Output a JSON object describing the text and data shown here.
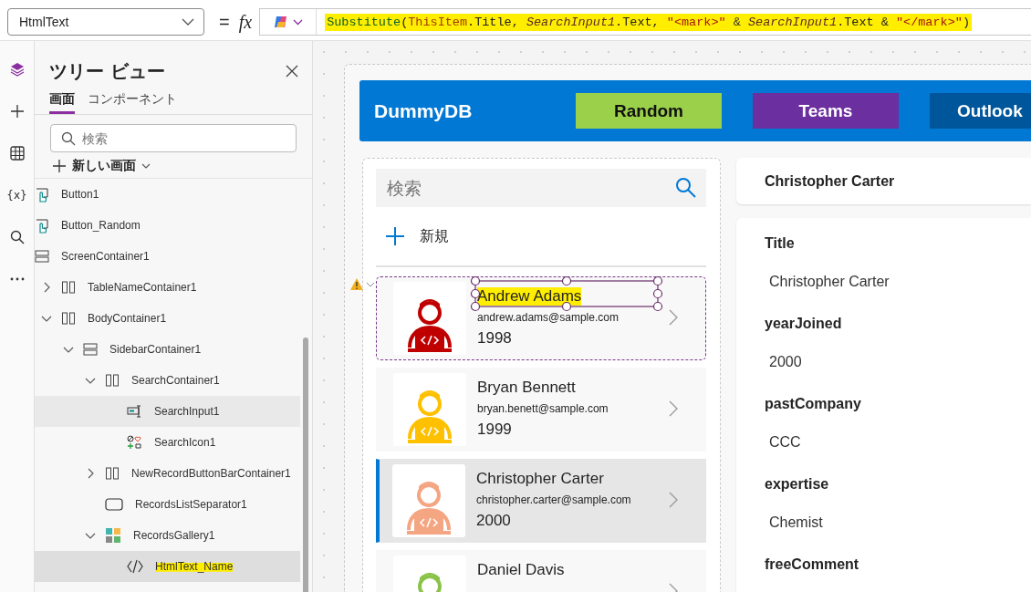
{
  "formula_bar": {
    "property": "HtmlText",
    "equals": "=",
    "fx": "fx",
    "tokens": [
      {
        "text": "Substitute",
        "kind": "function"
      },
      {
        "text": "(",
        "kind": "punct"
      },
      {
        "text": "ThisItem",
        "kind": "keyword"
      },
      {
        "text": ".Title, ",
        "kind": "punct"
      },
      {
        "text": "SearchInput1",
        "kind": "control"
      },
      {
        "text": ".Text, ",
        "kind": "punct"
      },
      {
        "text": "\"<mark>\"",
        "kind": "string"
      },
      {
        "text": " & ",
        "kind": "operator"
      },
      {
        "text": "SearchInput1",
        "kind": "control"
      },
      {
        "text": ".Text & ",
        "kind": "punct"
      },
      {
        "text": "\"</mark>\"",
        "kind": "string"
      },
      {
        "text": ")",
        "kind": "punct"
      }
    ],
    "highlighted": true
  },
  "rail": [
    {
      "kind": "layers",
      "selected": true
    },
    {
      "kind": "plus",
      "selected": false
    },
    {
      "kind": "table",
      "selected": false
    },
    {
      "kind": "variables",
      "glyph": "{x}",
      "selected": false
    },
    {
      "kind": "search",
      "selected": false
    },
    {
      "kind": "more",
      "selected": false
    }
  ],
  "tree_view": {
    "title": "ツリー ビュー",
    "tabs": [
      {
        "label": "画面",
        "selected": true
      },
      {
        "label": "コンポーネント",
        "selected": false
      }
    ],
    "search": {
      "placeholder": "検索"
    },
    "new_screen": "新しい画面",
    "items": [
      {
        "label": "Button1",
        "kind": "button",
        "selected": false,
        "hovered": false
      },
      {
        "label": "Button_Random",
        "kind": "button",
        "selected": false,
        "hovered": false
      },
      {
        "label": "ScreenContainer1",
        "kind": "vcontainer",
        "selected": false,
        "hovered": false,
        "children": [
          {
            "label": "TableNameContainer1",
            "kind": "hcontainer",
            "expanded": false,
            "selected": false,
            "hovered": false
          },
          {
            "label": "BodyContainer1",
            "kind": "hcontainer",
            "expanded": true,
            "selected": false,
            "hovered": false,
            "children": [
              {
                "label": "SidebarContainer1",
                "kind": "vcontainer",
                "expanded": true,
                "selected": false,
                "hovered": false,
                "children": [
                  {
                    "label": "SearchContainer1",
                    "kind": "hcontainer",
                    "expanded": true,
                    "selected": false,
                    "hovered": false,
                    "children": [
                      {
                        "label": "SearchInput1",
                        "kind": "textinput",
                        "selected": false,
                        "hovered": true
                      },
                      {
                        "label": "SearchIcon1",
                        "kind": "icons",
                        "selected": false,
                        "hovered": false
                      }
                    ]
                  },
                  {
                    "label": "NewRecordButtonBarContainer1",
                    "kind": "hcontainer",
                    "expanded": false,
                    "selected": false,
                    "hovered": false
                  },
                  {
                    "label": "RecordsListSeparator1",
                    "kind": "rectangle",
                    "selected": false,
                    "hovered": false
                  },
                  {
                    "label": "RecordsGallery1",
                    "kind": "gallery",
                    "expanded": true,
                    "selected": false,
                    "hovered": false,
                    "children": [
                      {
                        "label": "HtmlText_Name",
                        "kind": "html",
                        "selected": true,
                        "hovered": false,
                        "highlighted": true
                      }
                    ]
                  }
                ]
              }
            ]
          }
        ]
      }
    ]
  },
  "app": {
    "title": "DummyDB",
    "nav_buttons": [
      {
        "label": "Random",
        "color": "#9bd04a"
      },
      {
        "label": "Teams",
        "color": "#6b2fa0"
      },
      {
        "label": "Outlook",
        "color": "#00569b"
      }
    ],
    "search": {
      "placeholder": "検索"
    },
    "new_button": "新規",
    "records": [
      {
        "name": "Andrew Adams",
        "email": "andrew.adams@sample.com",
        "year": "1998",
        "color": "#c00000",
        "selected": false,
        "editor_selected": true,
        "name_highlighted": true,
        "warning": true
      },
      {
        "name": "Bryan Bennett",
        "email": "bryan.benett@sample.com",
        "year": "1999",
        "color": "#ffc000",
        "selected": false,
        "editor_selected": false,
        "name_highlighted": false,
        "warning": false
      },
      {
        "name": "Christopher Carter",
        "email": "christopher.carter@sample.com",
        "year": "2000",
        "color": "#f4a582",
        "selected": true,
        "editor_selected": false,
        "name_highlighted": false,
        "warning": false
      },
      {
        "name": "Daniel Davis",
        "color": "#8bc34a",
        "selected": false,
        "editor_selected": false,
        "name_highlighted": false,
        "warning": false
      }
    ],
    "detail": {
      "header": "Christopher Carter",
      "fields": [
        {
          "label": "Title",
          "value": "Christopher Carter"
        },
        {
          "label": "yearJoined",
          "value": "2000"
        },
        {
          "label": "pastCompany",
          "value": "CCC"
        },
        {
          "label": "expertise",
          "value": "Chemist"
        },
        {
          "label": "freeComment"
        }
      ]
    }
  }
}
